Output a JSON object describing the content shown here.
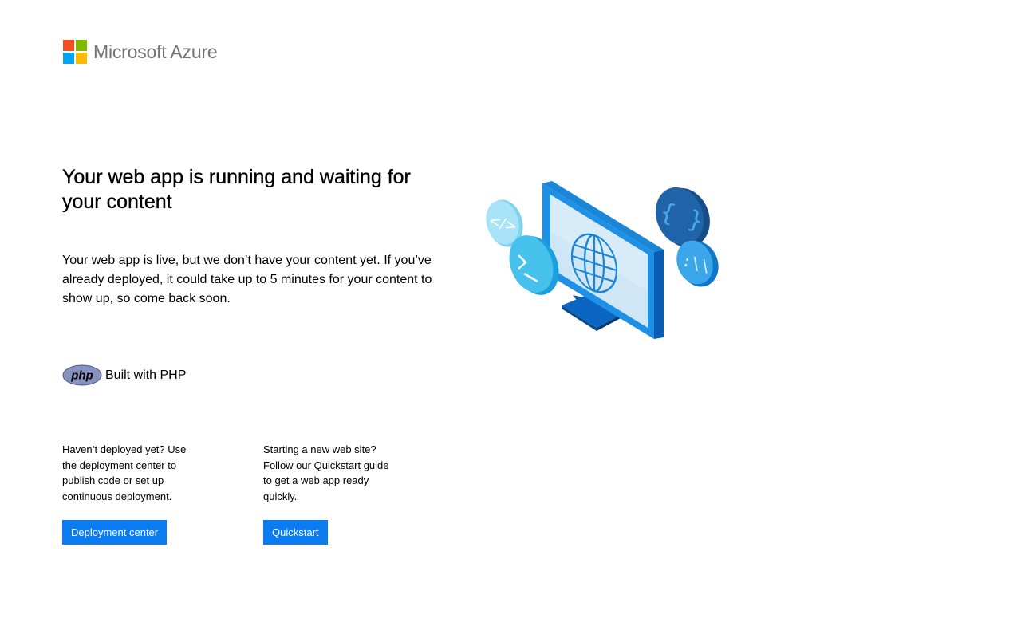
{
  "brand": {
    "name": "Microsoft Azure",
    "colors": {
      "red": "#f25022",
      "green": "#7fba00",
      "blue": "#00a4ef",
      "yellow": "#ffb900",
      "text": "#737373"
    }
  },
  "main": {
    "headline": "Your web app is running and waiting for your content",
    "intro": "Your web app is live, but we don’t have your content yet. If you’ve already deployed, it could take up to 5 minutes for your content to show up, so come back soon."
  },
  "stack": {
    "logo_text": "php",
    "label": "Built with PHP"
  },
  "columns": [
    {
      "text": "Haven’t deployed yet? Use the deployment center to publish code or set up continuous deployment.",
      "button": "Deployment center"
    },
    {
      "text": "Starting a new web site? Follow our Quickstart guide to get a web app ready quickly.",
      "button": "Quickstart"
    }
  ],
  "accent": "#0a7cf0",
  "icons": [
    "microsoft-logo-icon",
    "php-logo-icon",
    "monitor-globe-illustration",
    "code-tag-icon",
    "terminal-icon",
    "curly-braces-icon",
    "slash-icon"
  ]
}
